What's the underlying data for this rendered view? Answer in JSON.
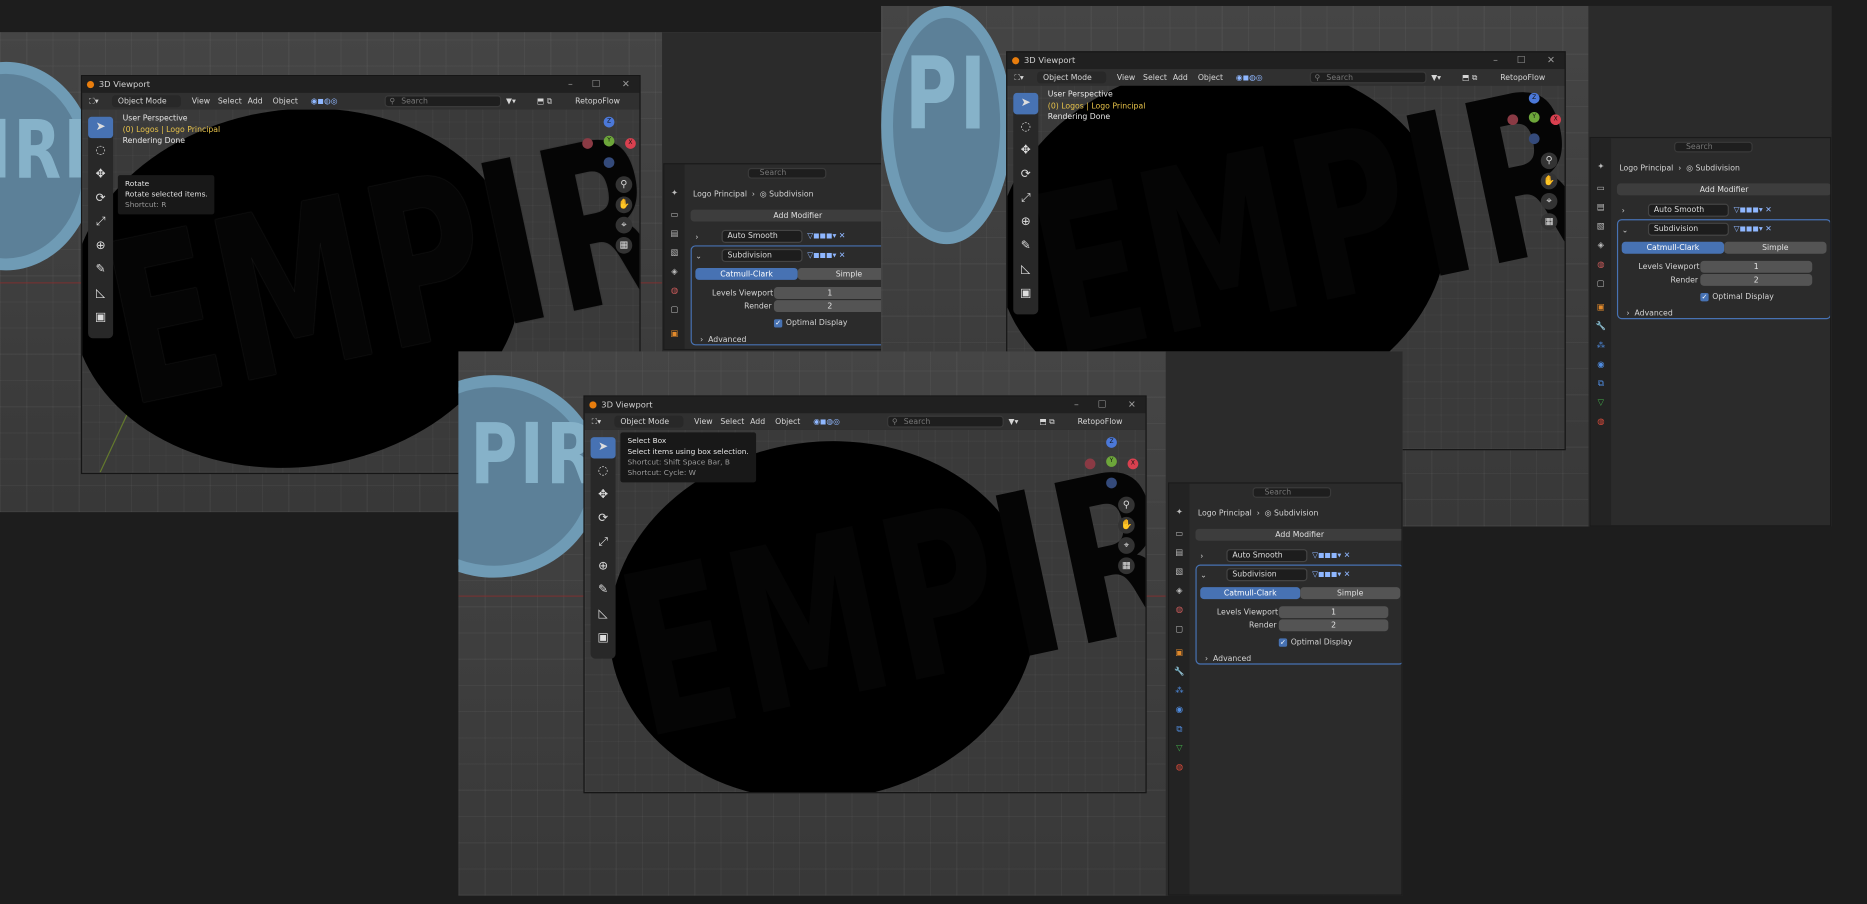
{
  "windows": [
    {
      "title": "3D Viewport",
      "mode": "Object Mode",
      "menu": [
        "View",
        "Select",
        "Add",
        "Object"
      ],
      "search_placeholder": "Search",
      "addon": "RetopoFlow",
      "overlay": {
        "perspective": "User Perspective",
        "collection": "(0) Logos | Logo Principal",
        "status": "Rendering Done"
      },
      "tooltip": {
        "title": "Rotate",
        "desc": "Rotate selected items.",
        "shortcut": "Shortcut: R"
      }
    },
    {
      "title": "3D Viewport",
      "mode": "Object Mode",
      "menu": [
        "View",
        "Select",
        "Add",
        "Object"
      ],
      "search_placeholder": "Search",
      "addon": "RetopoFlow",
      "overlay": {
        "perspective": "User Perspective",
        "collection": "(0) Logos | Logo Principal",
        "status": "Rendering Done"
      }
    },
    {
      "title": "3D Viewport",
      "mode": "Object Mode",
      "menu": [
        "View",
        "Select",
        "Add",
        "Object"
      ],
      "search_placeholder": "Search",
      "addon": "RetopoFlow",
      "tooltip": {
        "title": "Select Box",
        "desc": "Select items using box selection.",
        "shortcut": "Shortcut: Shift Space Bar, B",
        "shortcut2": "Shortcut: Cycle: W"
      }
    }
  ],
  "properties": {
    "search_placeholder": "Search",
    "breadcrumb_object": "Logo Principal",
    "breadcrumb_modifier": "Subdivision",
    "add_modifier": "Add Modifier",
    "modifiers": [
      "Auto Smooth",
      "Subdivision"
    ],
    "tabs": [
      "Catmull-Clark",
      "Simple"
    ],
    "levels_viewport_label": "Levels Viewport",
    "levels_viewport_value": "1",
    "render_label": "Render",
    "render_value": "2",
    "optimal_display": "Optimal Display",
    "advanced": "Advanced"
  },
  "logo_text": "EMPIRE",
  "colors": {
    "accent": "#4772b3",
    "bg": "#1d1d1d",
    "panel": "#2b2b2b",
    "logo_blue": "#6f9bb5",
    "header": "#303030"
  }
}
